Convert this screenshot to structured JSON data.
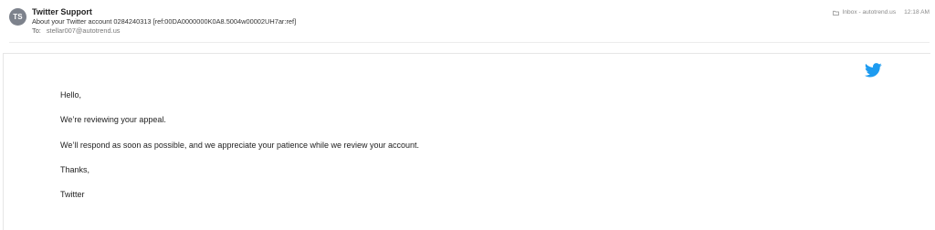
{
  "email": {
    "avatar_initials": "TS",
    "sender": "Twitter Support",
    "subject": "About your Twitter account 0284240313 [ref:00DA0000000K0A8.5004w00002UH7ar:ref]",
    "to_label": "To:",
    "to_value": "stellar007@autotrend.us",
    "folder": "Inbox - autotrend.us",
    "time": "12:18 AM"
  },
  "body": {
    "logo_icon": "twitter-bird-icon",
    "greeting": "Hello,",
    "line1": "We’re reviewing your appeal.",
    "line2": "We’ll respond as soon as possible, and we appreciate your patience while we review your account.",
    "closing": "Thanks,",
    "signature": "Twitter"
  },
  "colors": {
    "avatar_bg": "#7d828c",
    "twitter_blue": "#1d9bf0"
  }
}
